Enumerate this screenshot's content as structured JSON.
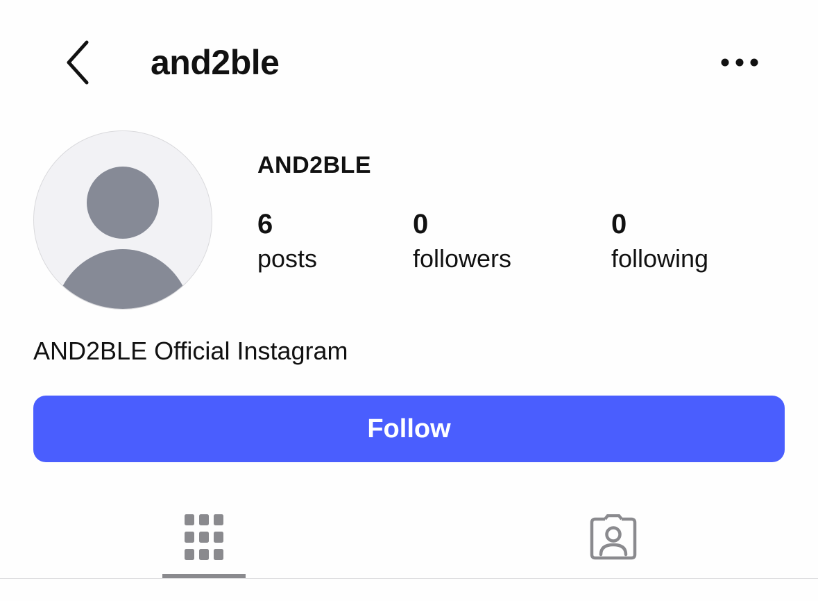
{
  "header": {
    "back_icon": "chevron-left-icon",
    "username": "and2ble",
    "more_icon": "more-horizontal-icon"
  },
  "profile": {
    "avatar_icon": "default-avatar-icon",
    "display_name": "AND2BLE",
    "bio": "AND2BLE Official Instagram"
  },
  "stats": {
    "posts": {
      "value": "6",
      "label": "posts"
    },
    "followers": {
      "value": "0",
      "label": "followers"
    },
    "following": {
      "value": "0",
      "label": "following"
    }
  },
  "actions": {
    "follow_label": "Follow"
  },
  "tabs": [
    {
      "icon": "grid-icon",
      "active": true
    },
    {
      "icon": "tagged-person-icon",
      "active": false
    }
  ],
  "colors": {
    "follow_button": "#4a5efe",
    "avatar_background": "#f2f2f5",
    "avatar_silhouette": "#868a96",
    "icon_gray": "#8a8a8e"
  }
}
